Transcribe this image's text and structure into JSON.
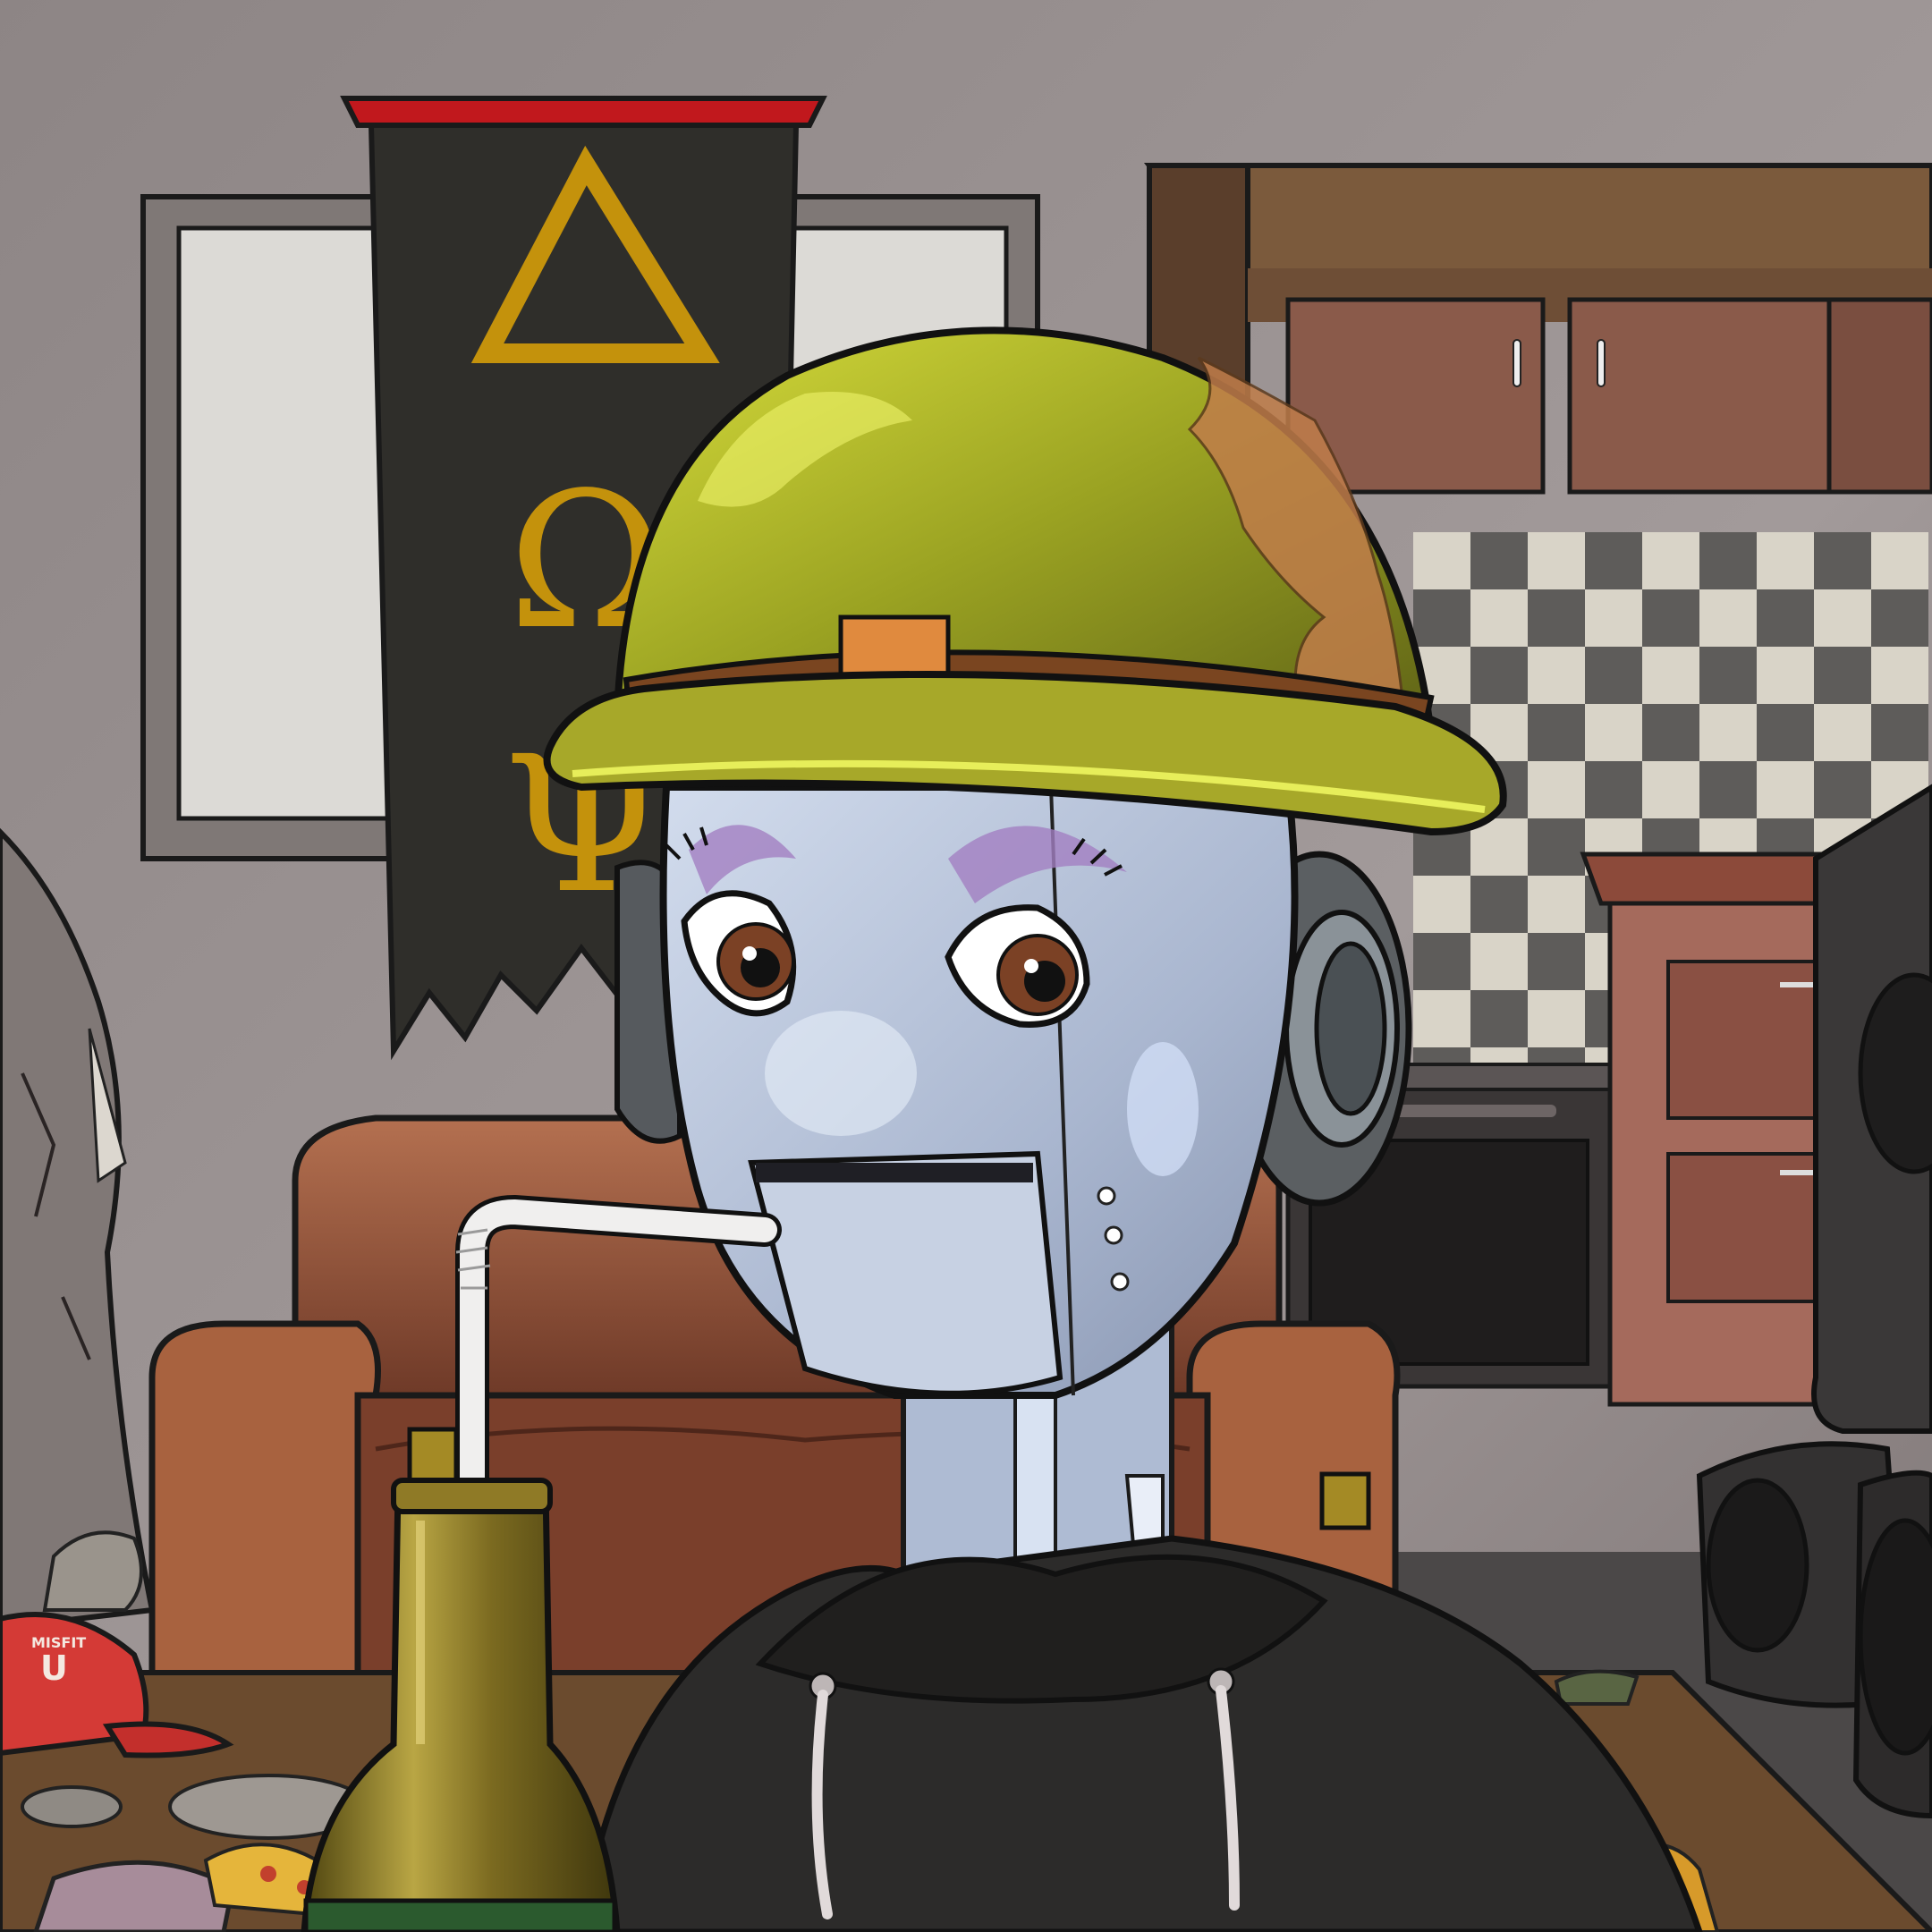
{
  "banner": {
    "letters": [
      "Δ",
      "Ω",
      "Ψ"
    ]
  },
  "cap": {
    "text": "MISFIT",
    "letter": "U"
  },
  "palette": {
    "wall": "#8e8686",
    "banner": "#2f2e2a",
    "banner_rod": "#c1181d",
    "gold": "#c4920c",
    "helmet": "#a8ad2a",
    "robot_face": "#b9c6dc",
    "hoodie": "#2c2b2a",
    "couch": "#9c5a3b",
    "cabinet": "#7a4e40",
    "bottle": "#7b6a20",
    "cap": "#d43a36"
  }
}
